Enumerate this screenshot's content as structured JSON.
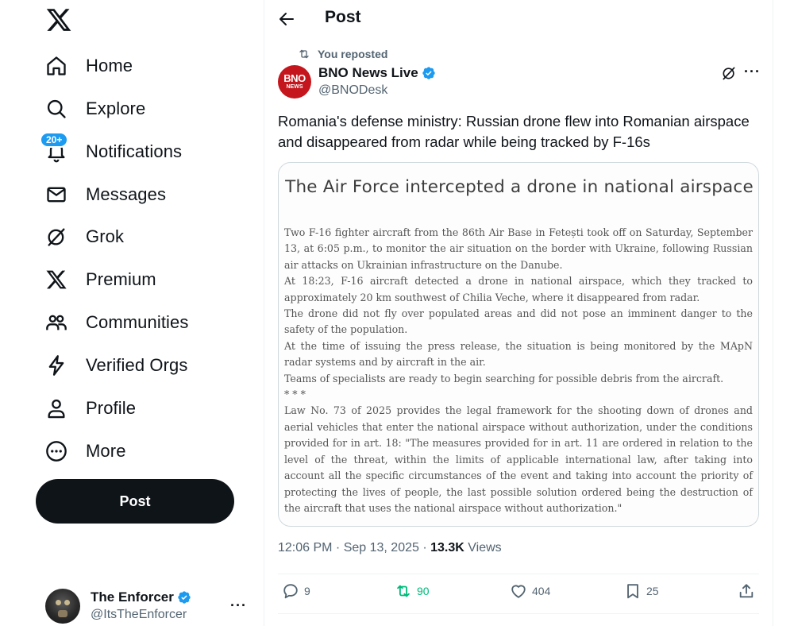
{
  "sidebar": {
    "nav": [
      {
        "label": "Home",
        "icon": "home-icon"
      },
      {
        "label": "Explore",
        "icon": "search-icon"
      },
      {
        "label": "Notifications",
        "icon": "bell-icon",
        "badge": "20+"
      },
      {
        "label": "Messages",
        "icon": "envelope-icon"
      },
      {
        "label": "Grok",
        "icon": "grok-icon"
      },
      {
        "label": "Premium",
        "icon": "x-logo-icon"
      },
      {
        "label": "Communities",
        "icon": "communities-icon"
      },
      {
        "label": "Verified Orgs",
        "icon": "lightning-icon"
      },
      {
        "label": "Profile",
        "icon": "person-icon"
      },
      {
        "label": "More",
        "icon": "more-circle-icon"
      }
    ],
    "post_button": "Post",
    "account": {
      "name": "The Enforcer",
      "handle": "@ItsTheEnforcer",
      "more": "···"
    }
  },
  "header": {
    "title": "Post"
  },
  "tweet": {
    "repost_label": "You reposted",
    "author": {
      "name": "BNO News Live",
      "handle": "@BNODesk",
      "avatar_top": "BNO",
      "avatar_bottom": "NEWS"
    },
    "more": "···",
    "text": "Romania's defense ministry: Russian drone flew into Romanian airspace and disappeared from radar while being tracked by F-16s",
    "media": {
      "title": "The Air Force intercepted a drone in national airspace",
      "paragraphs": [
        "Two F-16 fighter aircraft from the 86th Air Base in Fetești took off on Saturday, September 13, at 6:05 p.m., to monitor the air situation on the border with Ukraine, following Russian air attacks on Ukrainian infrastructure on the Danube.",
        "At 18:23, F-16 aircraft detected a drone in national airspace, which they tracked to approximately 20 km southwest of Chilia Veche, where it disappeared from radar.",
        "The drone did not fly over populated areas and did not pose an imminent danger to the safety of the population.",
        "At the time of issuing the press release, the situation is being monitored by the MApN radar systems and by aircraft in the air.",
        "Teams of specialists are ready to begin searching for possible debris from the aircraft.",
        "* * *",
        "Law No. 73 of 2025 provides the legal framework for the shooting down of drones and aerial vehicles that enter the national airspace without authorization, under the conditions provided for in art. 18: \"The measures provided for in art. 11 are ordered in relation to the level of the threat, within the limits of applicable international law, after taking into account all the specific circumstances of the event and taking into account the priority of protecting the lives of people, the last possible solution ordered being the destruction of the aircraft that uses the national airspace without authorization.\""
      ]
    },
    "time": "12:06 PM",
    "date": "Sep 13, 2025",
    "views_count": "13.3K",
    "views_label": "Views",
    "actions": {
      "replies": "9",
      "reposts": "90",
      "likes": "404",
      "bookmarks": "25"
    }
  },
  "colors": {
    "accent": "#1d9bf0",
    "repost_active": "#00ba7c",
    "text_primary": "#0f1419",
    "text_secondary": "#536471",
    "bno_red": "#c4161c"
  }
}
